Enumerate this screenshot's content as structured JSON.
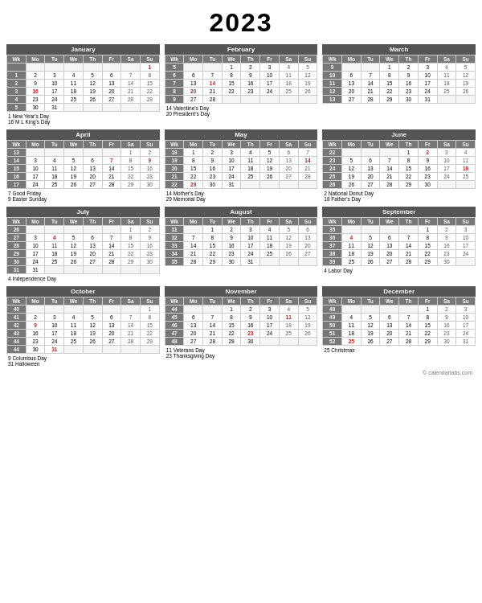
{
  "title": "2023",
  "months": [
    {
      "name": "January",
      "headers": [
        "Wk",
        "Mo",
        "Tu",
        "We",
        "Th",
        "Fr",
        "Sa",
        "Su"
      ],
      "rows": [
        [
          "",
          "",
          "",
          "",
          "",
          "",
          "",
          "1"
        ],
        [
          "1",
          "2",
          "3",
          "4",
          "5",
          "6",
          "7",
          "8"
        ],
        [
          "2",
          "9",
          "10",
          "11",
          "12",
          "13",
          "14",
          "15"
        ],
        [
          "3",
          "16",
          "17",
          "18",
          "19",
          "20",
          "21",
          "22"
        ],
        [
          "4",
          "23",
          "24",
          "25",
          "26",
          "27",
          "28",
          "29"
        ],
        [
          "5",
          "30",
          "31",
          "",
          "",
          "",
          "",
          ""
        ]
      ],
      "holidays": [
        "1 New Year's Day",
        "16 M L King's Day"
      ],
      "holiday_days": [
        "1",
        "16"
      ]
    },
    {
      "name": "February",
      "headers": [
        "Wk",
        "Mo",
        "Tu",
        "We",
        "Th",
        "Fr",
        "Sa",
        "Su"
      ],
      "rows": [
        [
          "5",
          "",
          "",
          "1",
          "2",
          "3",
          "4",
          "5"
        ],
        [
          "6",
          "6",
          "7",
          "8",
          "9",
          "10",
          "11",
          "12"
        ],
        [
          "7",
          "13",
          "14",
          "15",
          "16",
          "17",
          "18",
          "19"
        ],
        [
          "8",
          "20",
          "21",
          "22",
          "23",
          "24",
          "25",
          "26"
        ],
        [
          "9",
          "27",
          "28",
          "",
          "",
          "",
          "",
          ""
        ]
      ],
      "holidays": [
        "14 Valentine's Day",
        "20 President's Day"
      ],
      "holiday_days": [
        "14",
        "20"
      ]
    },
    {
      "name": "March",
      "headers": [
        "Wk",
        "Mo",
        "Tu",
        "We",
        "Th",
        "Fr",
        "Sa",
        "Su"
      ],
      "rows": [
        [
          "9",
          "",
          "",
          "1",
          "2",
          "3",
          "4",
          "5"
        ],
        [
          "10",
          "6",
          "7",
          "8",
          "9",
          "10",
          "11",
          "12"
        ],
        [
          "11",
          "13",
          "14",
          "15",
          "16",
          "17",
          "18",
          "19"
        ],
        [
          "12",
          "20",
          "21",
          "22",
          "23",
          "24",
          "25",
          "26"
        ],
        [
          "13",
          "27",
          "28",
          "29",
          "30",
          "31",
          "",
          ""
        ]
      ],
      "holidays": [],
      "holiday_days": []
    },
    {
      "name": "April",
      "headers": [
        "Wk",
        "Mo",
        "Tu",
        "We",
        "Th",
        "Fr",
        "Sa",
        "Su"
      ],
      "rows": [
        [
          "13",
          "",
          "",
          "",
          "",
          "",
          "1",
          "2"
        ],
        [
          "14",
          "3",
          "4",
          "5",
          "6",
          "7",
          "8",
          "9"
        ],
        [
          "15",
          "10",
          "11",
          "12",
          "13",
          "14",
          "15",
          "16"
        ],
        [
          "16",
          "17",
          "18",
          "19",
          "20",
          "21",
          "22",
          "23"
        ],
        [
          "17",
          "24",
          "25",
          "26",
          "27",
          "28",
          "29",
          "30"
        ]
      ],
      "holidays": [
        "7 Good Friday",
        "9 Easter Sunday"
      ],
      "holiday_days": [
        "7",
        "9"
      ]
    },
    {
      "name": "May",
      "headers": [
        "Wk",
        "Mo",
        "Tu",
        "We",
        "Th",
        "Fr",
        "Sa",
        "Su"
      ],
      "rows": [
        [
          "18",
          "1",
          "2",
          "3",
          "4",
          "5",
          "6",
          "7"
        ],
        [
          "19",
          "8",
          "9",
          "10",
          "11",
          "12",
          "13",
          "14"
        ],
        [
          "20",
          "15",
          "16",
          "17",
          "18",
          "19",
          "20",
          "21"
        ],
        [
          "21",
          "22",
          "23",
          "24",
          "25",
          "26",
          "27",
          "28"
        ],
        [
          "22",
          "29",
          "30",
          "31",
          "",
          "",
          "",
          ""
        ]
      ],
      "holidays": [
        "14 Mother's Day",
        "29 Memorial Day"
      ],
      "holiday_days": [
        "14",
        "29"
      ]
    },
    {
      "name": "June",
      "headers": [
        "Wk",
        "Mo",
        "Tu",
        "We",
        "Th",
        "Fr",
        "Sa",
        "Su"
      ],
      "rows": [
        [
          "22",
          "",
          "",
          "",
          "1",
          "2",
          "3",
          "4"
        ],
        [
          "23",
          "5",
          "6",
          "7",
          "8",
          "9",
          "10",
          "11"
        ],
        [
          "24",
          "12",
          "13",
          "14",
          "15",
          "16",
          "17",
          "18"
        ],
        [
          "25",
          "19",
          "20",
          "21",
          "22",
          "23",
          "24",
          "25"
        ],
        [
          "26",
          "26",
          "27",
          "28",
          "29",
          "30",
          "",
          ""
        ]
      ],
      "holidays": [
        "2 National Donut Day",
        "18 Father's Day"
      ],
      "holiday_days": [
        "2",
        "18"
      ]
    },
    {
      "name": "July",
      "headers": [
        "Wk",
        "Mo",
        "Tu",
        "We",
        "Th",
        "Fr",
        "Sa",
        "Su"
      ],
      "rows": [
        [
          "26",
          "",
          "",
          "",
          "",
          "",
          "1",
          "2"
        ],
        [
          "27",
          "3",
          "4",
          "5",
          "6",
          "7",
          "8",
          "9"
        ],
        [
          "28",
          "10",
          "11",
          "12",
          "13",
          "14",
          "15",
          "16"
        ],
        [
          "29",
          "17",
          "18",
          "19",
          "20",
          "21",
          "22",
          "23"
        ],
        [
          "30",
          "24",
          "25",
          "26",
          "27",
          "28",
          "29",
          "30"
        ],
        [
          "31",
          "31",
          "",
          "",
          "",
          "",
          "",
          ""
        ]
      ],
      "holidays": [
        "4 Independence Day"
      ],
      "holiday_days": [
        "4"
      ]
    },
    {
      "name": "August",
      "headers": [
        "Wk",
        "Mo",
        "Tu",
        "We",
        "Th",
        "Fr",
        "Sa",
        "Su"
      ],
      "rows": [
        [
          "31",
          "",
          "1",
          "2",
          "3",
          "4",
          "5",
          "6"
        ],
        [
          "32",
          "7",
          "8",
          "9",
          "10",
          "11",
          "12",
          "13"
        ],
        [
          "33",
          "14",
          "15",
          "16",
          "17",
          "18",
          "19",
          "20"
        ],
        [
          "34",
          "21",
          "22",
          "23",
          "24",
          "25",
          "26",
          "27"
        ],
        [
          "35",
          "28",
          "29",
          "30",
          "31",
          "",
          "",
          ""
        ]
      ],
      "holidays": [],
      "holiday_days": []
    },
    {
      "name": "September",
      "headers": [
        "Wk",
        "Mo",
        "Tu",
        "We",
        "Th",
        "Fr",
        "Sa",
        "Su"
      ],
      "rows": [
        [
          "35",
          "",
          "",
          "",
          "",
          "1",
          "2",
          "3"
        ],
        [
          "36",
          "4",
          "5",
          "6",
          "7",
          "8",
          "9",
          "10"
        ],
        [
          "37",
          "11",
          "12",
          "13",
          "14",
          "15",
          "16",
          "17"
        ],
        [
          "38",
          "18",
          "19",
          "20",
          "21",
          "22",
          "23",
          "24"
        ],
        [
          "39",
          "25",
          "26",
          "27",
          "28",
          "29",
          "30",
          ""
        ]
      ],
      "holidays": [
        "4 Labor Day"
      ],
      "holiday_days": [
        "4"
      ]
    },
    {
      "name": "October",
      "headers": [
        "Wk",
        "Mo",
        "Tu",
        "We",
        "Th",
        "Fr",
        "Sa",
        "Su"
      ],
      "rows": [
        [
          "40",
          "",
          "",
          "",
          "",
          "",
          "",
          "1"
        ],
        [
          "41",
          "2",
          "3",
          "4",
          "5",
          "6",
          "7",
          "8"
        ],
        [
          "42",
          "9",
          "10",
          "11",
          "12",
          "13",
          "14",
          "15"
        ],
        [
          "43",
          "16",
          "17",
          "18",
          "19",
          "20",
          "21",
          "22"
        ],
        [
          "44",
          "23",
          "24",
          "25",
          "26",
          "27",
          "28",
          "29"
        ],
        [
          "44",
          "30",
          "31",
          "",
          "",
          "",
          "",
          ""
        ]
      ],
      "holidays": [
        "9 Columbus Day",
        "31 Halloween"
      ],
      "holiday_days": [
        "9",
        "31"
      ]
    },
    {
      "name": "November",
      "headers": [
        "Wk",
        "Mo",
        "Tu",
        "We",
        "Th",
        "Fr",
        "Sa",
        "Su"
      ],
      "rows": [
        [
          "44",
          "",
          "",
          "1",
          "2",
          "3",
          "4",
          "5"
        ],
        [
          "45",
          "6",
          "7",
          "8",
          "9",
          "10",
          "11",
          "12"
        ],
        [
          "46",
          "13",
          "14",
          "15",
          "16",
          "17",
          "18",
          "19"
        ],
        [
          "47",
          "20",
          "21",
          "22",
          "23",
          "24",
          "25",
          "26"
        ],
        [
          "48",
          "27",
          "28",
          "29",
          "30",
          "",
          "",
          ""
        ]
      ],
      "holidays": [
        "11 Veterans Day",
        "23 Thanksgiving Day"
      ],
      "holiday_days": [
        "11",
        "23"
      ]
    },
    {
      "name": "December",
      "headers": [
        "Wk",
        "Mo",
        "Tu",
        "We",
        "Th",
        "Fr",
        "Sa",
        "Su"
      ],
      "rows": [
        [
          "48",
          "",
          "",
          "",
          "",
          "1",
          "2",
          "3"
        ],
        [
          "49",
          "4",
          "5",
          "6",
          "7",
          "8",
          "9",
          "10"
        ],
        [
          "50",
          "11",
          "12",
          "13",
          "14",
          "15",
          "16",
          "17"
        ],
        [
          "51",
          "18",
          "19",
          "20",
          "21",
          "22",
          "23",
          "24"
        ],
        [
          "52",
          "25",
          "26",
          "27",
          "28",
          "29",
          "30",
          "31"
        ]
      ],
      "holidays": [
        "25 Christmas"
      ],
      "holiday_days": [
        "25"
      ]
    }
  ],
  "footer": "© calendarlabs.com"
}
